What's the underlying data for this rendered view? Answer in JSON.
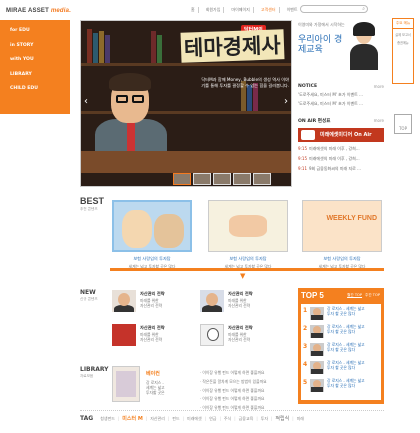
{
  "header": {
    "logo_text": "MIRAE ASSET",
    "logo_accent": "media.",
    "topnav": [
      "홈",
      "회원가입",
      "마이페이지",
      "고객센터",
      "이벤트"
    ],
    "topnav_active": 3
  },
  "leftmenu": [
    "for EDU",
    "in STORY",
    "with YOU",
    "LIBRARY",
    "CHILD EDU"
  ],
  "hero": {
    "badge": "닥터M의",
    "title": "테마경제사",
    "description": "닥터M과 함께 Money, Bubble의 생성 역사 이야기를 통해 투자를 결정할 수 있는 힘을 길러봅니다."
  },
  "promo": {
    "small": "이영미와 가정에서 시작하는",
    "big": "우리아이 경제교육"
  },
  "notice": {
    "title": "NOTICE",
    "more": "more",
    "items": [
      "'도로주세요, 미스터 M' 초가 이벤트 ...",
      "'도로주세요, 미스터 M' 초가 이벤트 ..."
    ]
  },
  "onair": {
    "title": "ON AIR 편성표",
    "more": "more",
    "bar_label": "미래에셋미디어 On Air",
    "items": [
      {
        "time": "9:15",
        "text": "미래에셋의 미래 이후 , 강희..."
      },
      {
        "time": "9:15",
        "text": "미래에셋의 미래 이후 , 강희..."
      },
      {
        "time": "9:11",
        "text": "9회 금융동화씨의 미래 지로 ..."
      }
    ]
  },
  "quick": {
    "header": "주요 메뉴",
    "items": [
      "실제 보고서",
      "증권메뉴"
    ]
  },
  "topbtn": "TOP",
  "best": {
    "title": "BEST",
    "subtitle": "추천 콘텐츠",
    "cards": [
      {
        "title": "보험 사랑임의 투자탐",
        "sub": "세계는 넓고 투자할 곳은 많다"
      },
      {
        "title": "보험 사랑임의 투자탐",
        "sub": "세계는 넓고 투자할 곳은 많다"
      },
      {
        "title": "보험 사랑임의 투자탐",
        "sub": "세계는 넓고 투자할 곳은 많다"
      }
    ],
    "weekly": "WEEKLY FUND"
  },
  "new": {
    "title": "NEW",
    "subtitle": "신규 콘텐츠",
    "items": [
      {
        "title": "자산관리 전략",
        "desc1": "미래를 위한",
        "desc2": "자산관리 전략"
      },
      {
        "title": "자산관리 전략",
        "desc1": "미래를 위한",
        "desc2": "자산관리 전략"
      },
      {
        "title": "자산관리 전략",
        "desc1": "미래를 위한",
        "desc2": "자산관리 전략"
      },
      {
        "title": "자산관리 전략",
        "desc1": "미래를 위한",
        "desc2": "자산관리 전략"
      }
    ]
  },
  "top5": {
    "title": "TOP 5",
    "tabs": [
      "월간 TOP",
      "주간 TOP"
    ],
    "items": [
      {
        "n": "1",
        "l1": "강 로지스 - 세계는 넓고",
        "l2": "투자 할 곳은 많다"
      },
      {
        "n": "2",
        "l1": "강 로지스 - 세계는 넓고",
        "l2": "투자 할 곳은 많다"
      },
      {
        "n": "3",
        "l1": "강 로지스 - 세계는 넓고",
        "l2": "투자 할 곳은 많다"
      },
      {
        "n": "4",
        "l1": "강 로지스 - 세계는 넓고",
        "l2": "투자 할 곳은 많다"
      },
      {
        "n": "5",
        "l1": "강 로지스 - 세계는 넓고",
        "l2": "투자 할 곳은 많다"
      }
    ]
  },
  "library": {
    "title": "LIBRARY",
    "subtitle": "자료모음",
    "book_title": "베이컨",
    "book_desc": [
      "강 로지스 -",
      "세계는 넓고",
      "투자할 곳은"
    ],
    "list": [
      "· 이이장 유행 펀드 어떻게 하면 좋을까요",
      "· 작은돈을 알차게 모으는 방법이 있을까요",
      "· 이이장 유행 펀드 어떻게 하면 좋을까요",
      "· 이이장 유행 펀드 어떻게 하면 좋을까요",
      "· 이이장 유행 펀드 어떻게 하면 좋을까요"
    ]
  },
  "tags": {
    "label": "TAG",
    "items": [
      "청생펀드",
      "미스터 M",
      "자산관리",
      "펀드",
      "미래에셋",
      "연금",
      "주식",
      "금융교육",
      "투자",
      "적립식",
      "미래"
    ]
  }
}
